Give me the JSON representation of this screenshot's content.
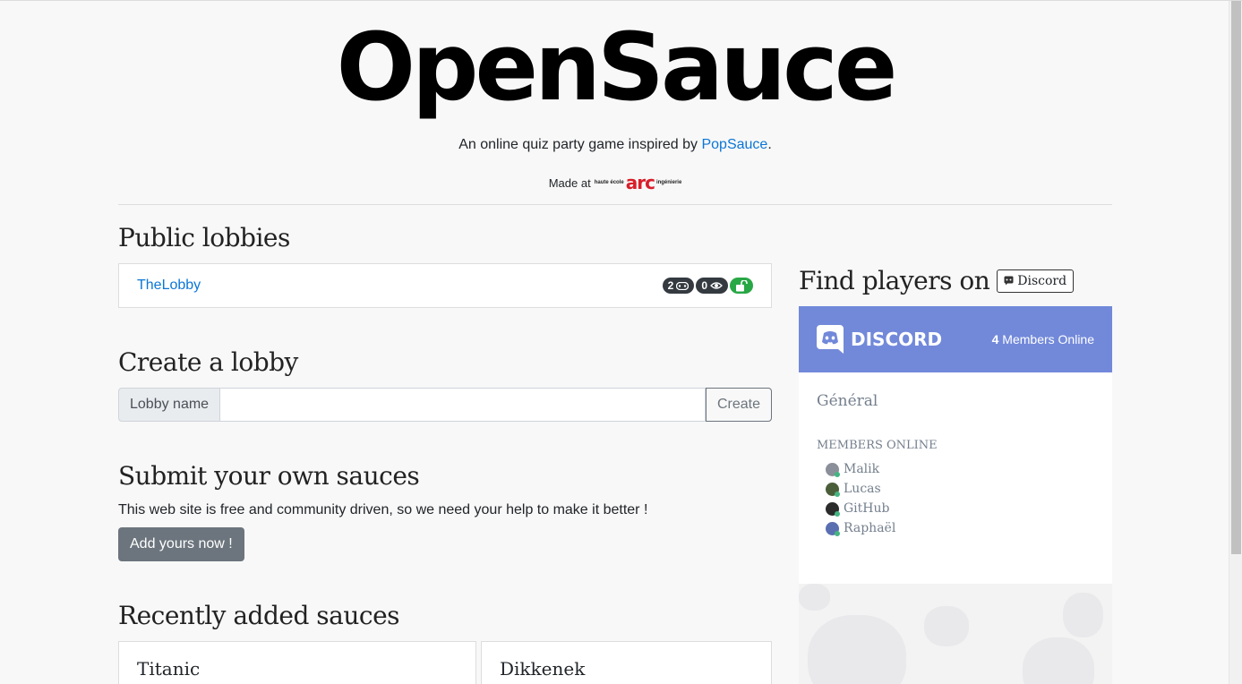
{
  "header": {
    "brand": "OpenSauce",
    "tagline_text": "An online quiz party game inspired by ",
    "tagline_link": "PopSauce",
    "tagline_end": ".",
    "made_at": "Made at",
    "arc_top": "haute école",
    "arc_main": "arc",
    "arc_right": "ingénierie"
  },
  "public_lobbies": {
    "title": "Public lobbies",
    "items": [
      {
        "name": "TheLobby",
        "players": "2",
        "spectators": "0"
      }
    ]
  },
  "create_lobby": {
    "title": "Create a lobby",
    "label": "Lobby name",
    "value": "",
    "button": "Create"
  },
  "submit": {
    "title": "Submit your own sauces",
    "text": "This web site is free and community driven, so we need your help to make it better !",
    "button": "Add yours now !"
  },
  "recent": {
    "title": "Recently added sauces",
    "items": [
      "Titanic",
      "Dikkenek"
    ]
  },
  "discord": {
    "find_text": "Find players on",
    "tag": "Discord",
    "logo_text": "DISCORD",
    "online_count": "4",
    "online_label": "Members Online",
    "channel": "Général",
    "members_title": "MEMBERS ONLINE",
    "members": [
      "Malik",
      "Lucas",
      "GitHub",
      "Raphaël"
    ]
  }
}
